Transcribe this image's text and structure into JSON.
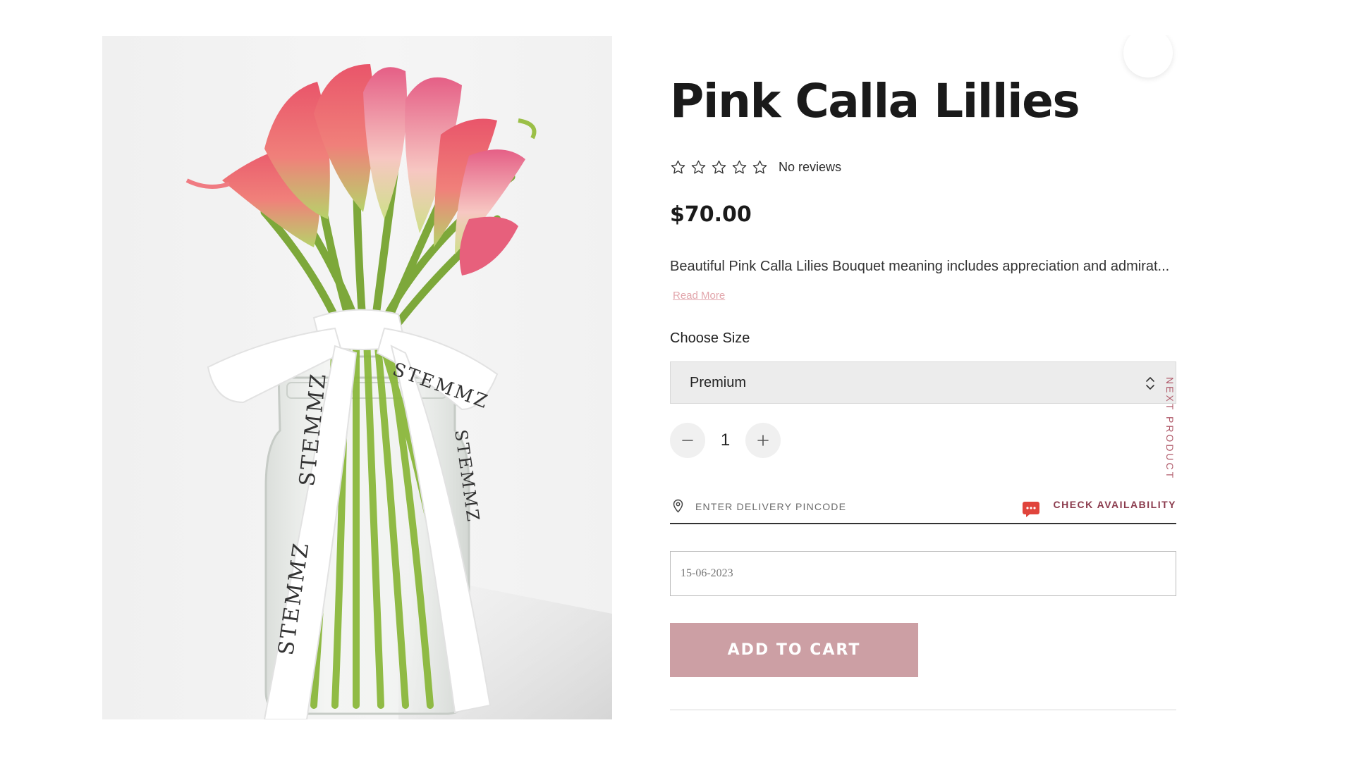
{
  "product": {
    "title": "Pink Calla Lillies",
    "rating": {
      "stars_filled": 0,
      "stars_total": 5,
      "reviews_text": "No reviews"
    },
    "price": "$70.00",
    "description": "Beautiful Pink Calla Lilies Bouquet meaning includes appreciation and admirat...",
    "read_more_label": "Read More",
    "image_brand_text": "STEMMZ"
  },
  "size": {
    "label": "Choose Size",
    "selected": "Premium"
  },
  "quantity": {
    "value": "1"
  },
  "delivery": {
    "pincode_placeholder": "ENTER DELIVERY PINCODE",
    "check_label": "CHECK AVAILABILITY",
    "date_value": "15-06-2023"
  },
  "next_product_label": "NEXT PRODUCT",
  "cart": {
    "add_label": "ADD TO CART"
  },
  "colors": {
    "accent_pink": "#cc9fa4",
    "link_pink": "#e2a6ac",
    "check_text": "#8a3a4c",
    "select_bg": "#ececec",
    "chat_icon": "#e0443c"
  },
  "icons": {
    "star": "star-outline-icon",
    "pin": "map-pin-icon",
    "chat": "chat-bubble-icon",
    "select": "up-down-chevron-icon",
    "minus": "minus-icon",
    "plus": "plus-icon"
  }
}
